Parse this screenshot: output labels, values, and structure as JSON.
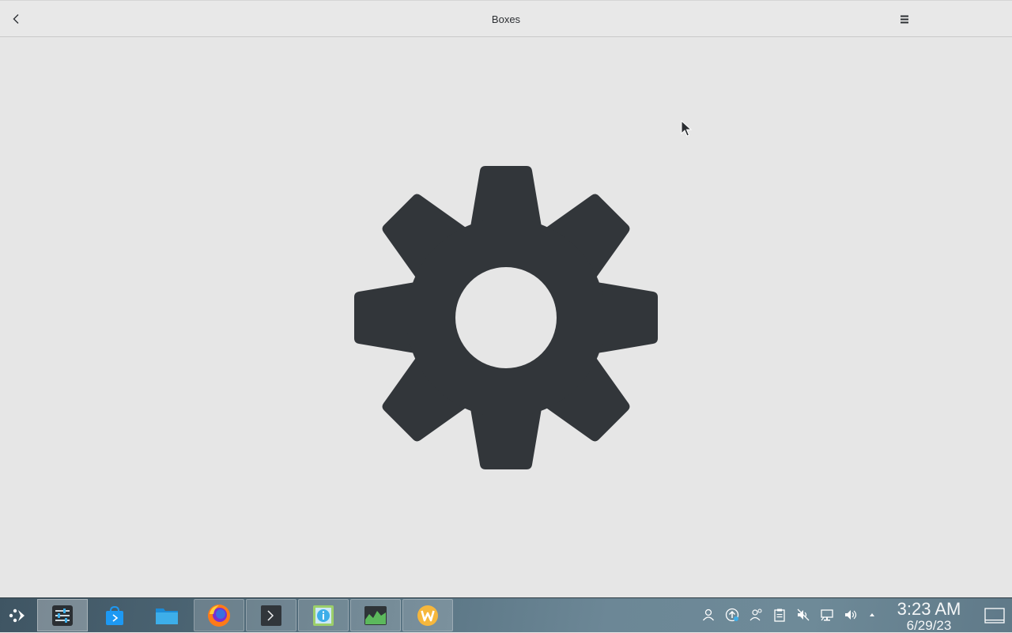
{
  "header": {
    "title": "Boxes"
  },
  "main": {
    "placeholder_icon": "gear-icon"
  },
  "taskbar": {
    "launcher_icon": "application-launcher-icon",
    "apps": [
      {
        "name": "system-settings-icon",
        "state": "active"
      },
      {
        "name": "discover-store-icon",
        "state": "idle"
      },
      {
        "name": "file-manager-icon",
        "state": "idle"
      },
      {
        "name": "firefox-icon",
        "state": "running"
      },
      {
        "name": "terminal-icon",
        "state": "running"
      },
      {
        "name": "system-info-icon",
        "state": "running"
      },
      {
        "name": "system-monitor-icon",
        "state": "running"
      },
      {
        "name": "w-app-icon",
        "state": "running"
      }
    ],
    "tray": [
      "user-icon",
      "updates-icon",
      "user-switch-icon",
      "clipboard-icon",
      "audio-muted-icon",
      "network-icon",
      "volume-icon",
      "expand-tray-icon"
    ],
    "clock": {
      "time": "3:23 AM",
      "date": "6/29/23"
    }
  },
  "colors": {
    "gear": "#32363a",
    "background": "#e6e6e6",
    "taskbar": "#5a7483"
  }
}
